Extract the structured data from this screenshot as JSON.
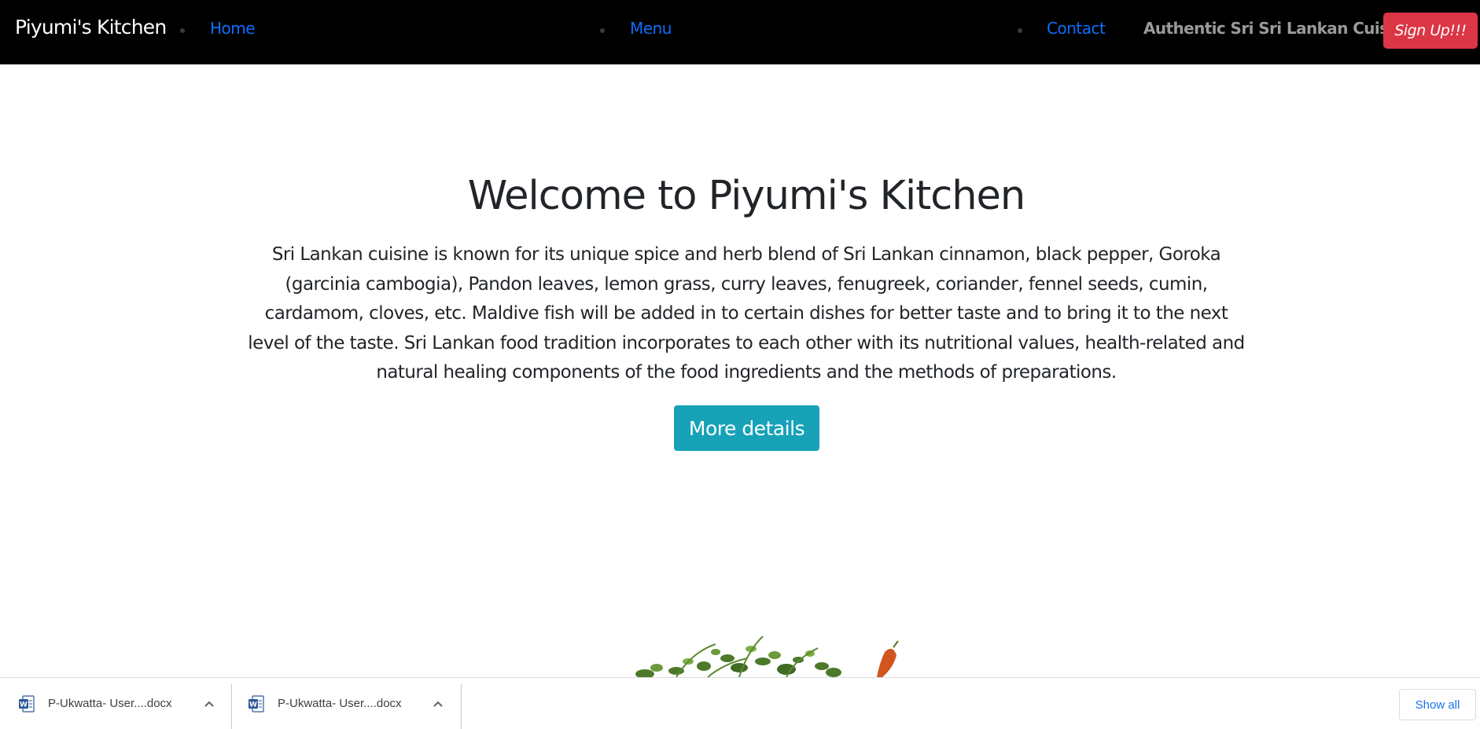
{
  "navbar": {
    "brand": "Piyumi's Kitchen",
    "links": [
      {
        "label": "Home"
      },
      {
        "label": "Menu"
      },
      {
        "label": "Contact"
      }
    ],
    "tagline": "Authentic Sri Sri Lankan Cuisin!!",
    "signup_label": "Sign Up!!!"
  },
  "hero": {
    "title": "Welcome to Piyumi's Kitchen",
    "description": "Sri Lankan cuisine is known for its unique spice and herb blend of Sri Lankan cinnamon, black pepper, Goroka (garcinia cambogia), Pandon leaves, lemon grass, curry leaves, fenugreek, coriander, fennel seeds, cumin, cardamom, cloves, etc. Maldive fish will be added in to certain dishes for better taste and to bring it to the next level of the taste. Sri Lankan food tradition incorporates to each other with its nutritional values, health-related and natural healing components of the food ingredients and the methods of preparations.",
    "button_label": "More details"
  },
  "download_bar": {
    "items": [
      {
        "name": "P-Ukwatta- User....docx",
        "icon": "word-doc-icon"
      },
      {
        "name": "P-Ukwatta- User....docx",
        "icon": "word-doc-icon"
      }
    ],
    "show_all_label": "Show all"
  },
  "colors": {
    "navbar_bg": "#000000",
    "link": "#0d6efd",
    "signup_bg": "#dc3545",
    "button_bg": "#17a2b8",
    "show_all_text": "#1a73e8"
  }
}
